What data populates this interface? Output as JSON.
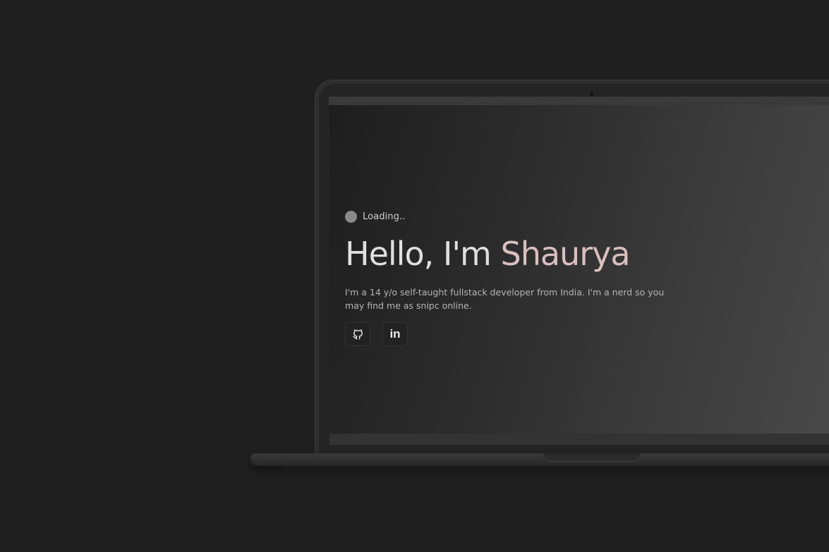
{
  "hero": {
    "loading_text": "Loading..",
    "greeting": "Hello, I'm",
    "name": "Shaurya",
    "bio": "I'm a 14 y/o self-taught fullstack developer from India. I'm a nerd so you may find me as snipc online."
  },
  "socials": [
    {
      "icon": "github-icon",
      "label": "GitHub"
    },
    {
      "icon": "linkedin-icon",
      "text": "in",
      "label": "LinkedIn"
    }
  ],
  "colors": {
    "background": "#1f1f1f",
    "name_accent": "#d9bfbf",
    "headline": "#e0e0e0",
    "bio_text": "#b5b5b5"
  }
}
